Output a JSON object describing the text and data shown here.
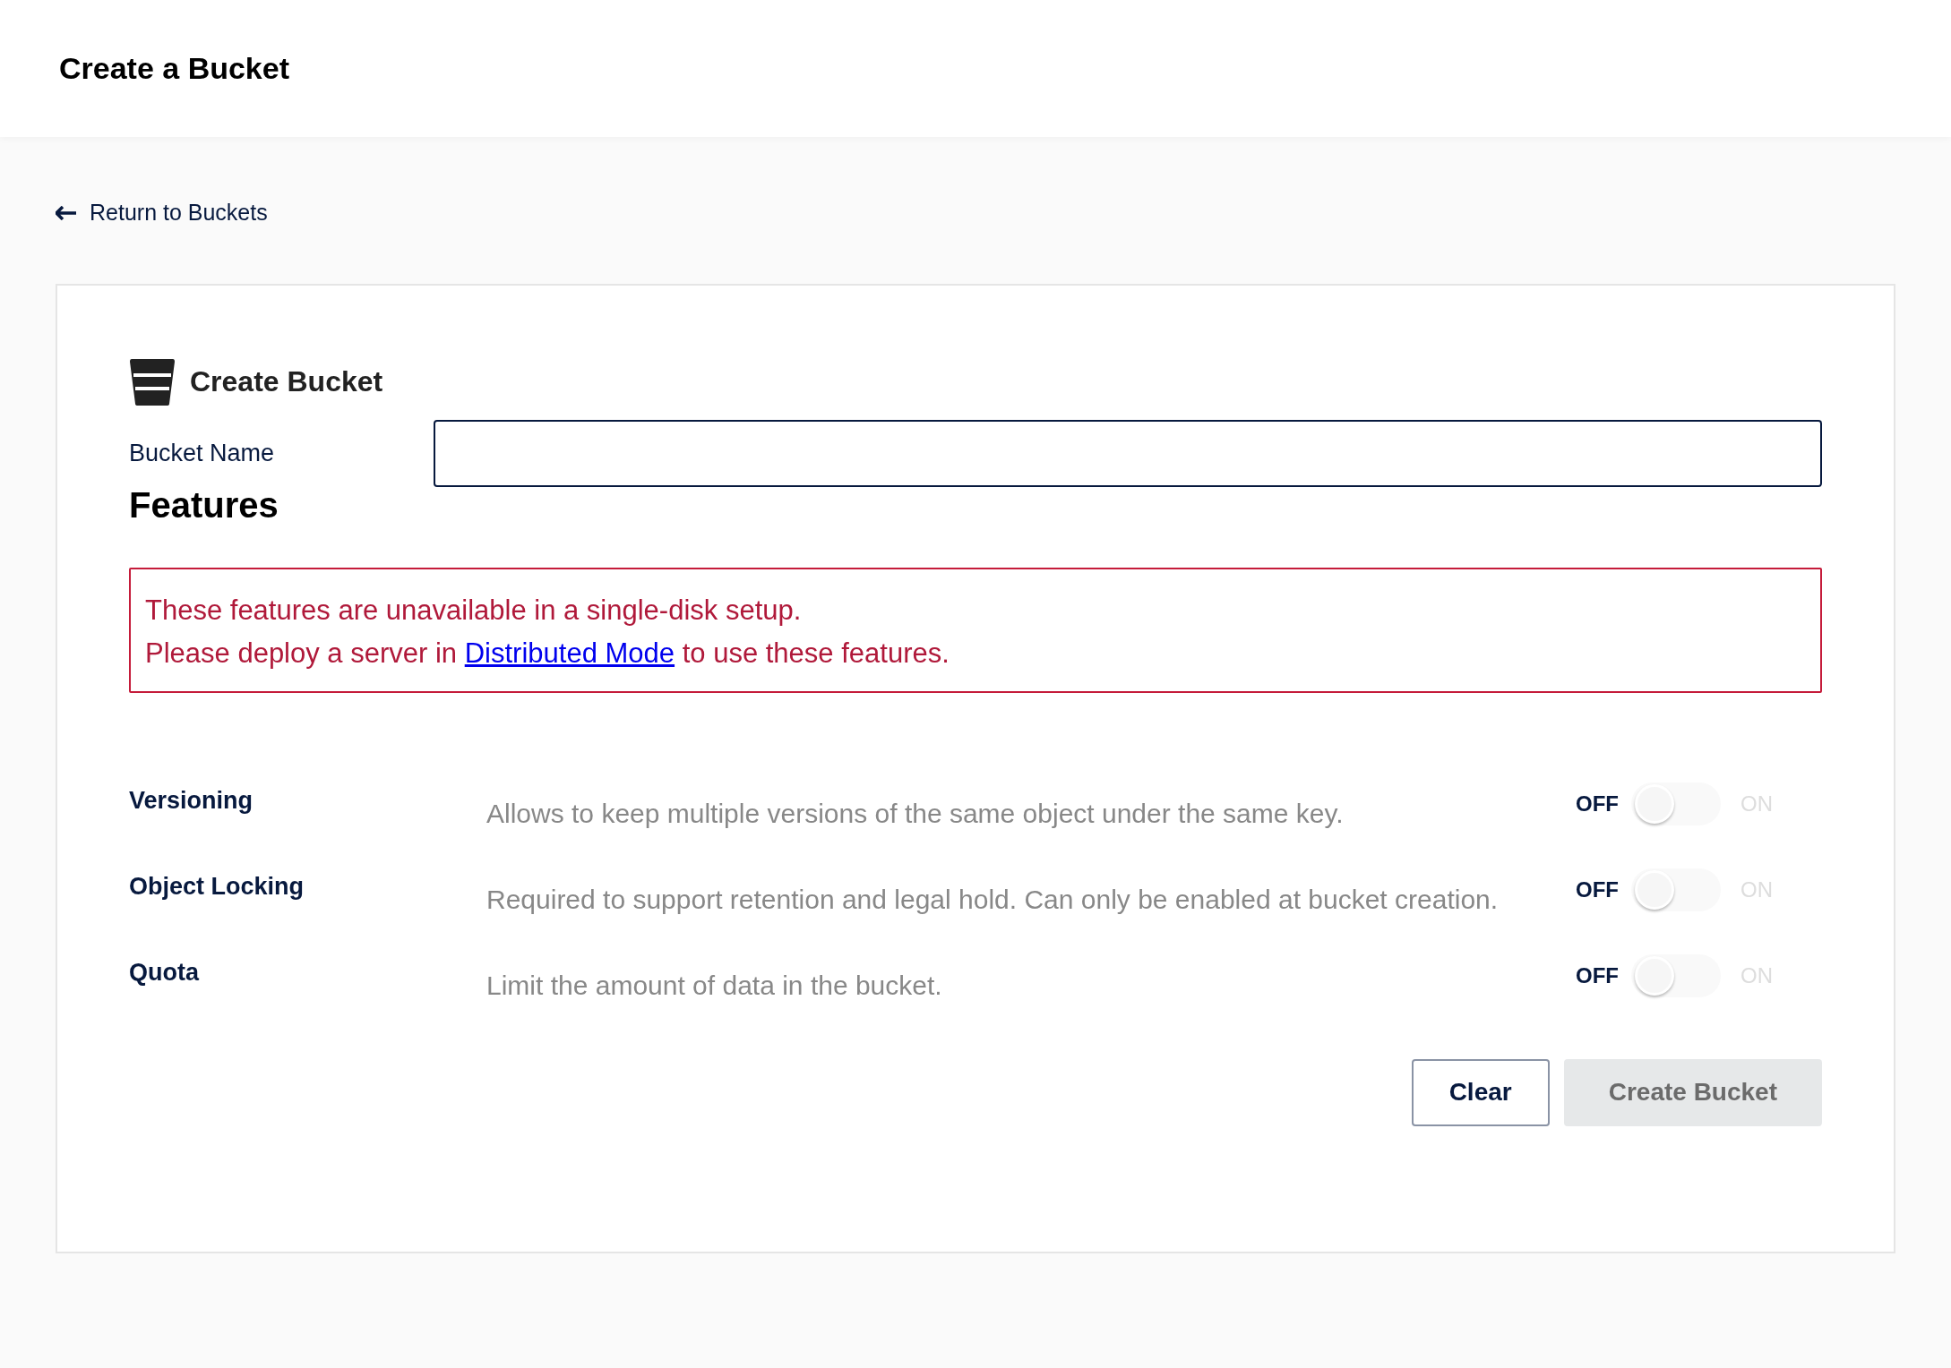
{
  "header": {
    "title": "Create a Bucket"
  },
  "back_link": {
    "label": "Return to Buckets"
  },
  "form": {
    "title": "Create Bucket",
    "bucket_name": {
      "label": "Bucket Name"
    },
    "features_heading": "Features",
    "alert": {
      "line_1": "These features are unavailable in a single-disk setup.",
      "line_2_before": "Please deploy a server in",
      "link": "Distributed Mode",
      "line_2_after": "to use these features."
    },
    "features": [
      {
        "name": "Versioning",
        "description": "Allows to keep multiple versions of the same object under the same key.",
        "off_label": "OFF",
        "on_label": "ON",
        "on": false
      },
      {
        "name": "Object Locking",
        "description": "Required to support retention and legal hold. Can only be enabled at bucket creation.",
        "off_label": "OFF",
        "on_label": "ON",
        "on": false
      },
      {
        "name": "Quota",
        "description": "Limit the amount of data in the bucket.",
        "off_label": "OFF",
        "on_label": "ON",
        "on": false
      }
    ],
    "buttons": [
      {
        "label": "Clear",
        "kind": "outline",
        "disabled": false
      },
      {
        "label": "Create Bucket",
        "kind": "primary",
        "disabled": true
      }
    ]
  }
}
